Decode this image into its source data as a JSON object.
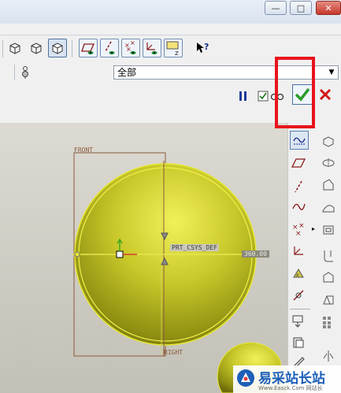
{
  "window": {
    "minimize_label": "—",
    "maximize_label": "□",
    "close_label": "✕"
  },
  "filter": {
    "selected": "全部"
  },
  "graphics": {
    "labels": {
      "front": "FRONT",
      "right": "RIGHT",
      "csys": "PRT_CSYS_DEF",
      "dimension": "360.00"
    }
  },
  "toolbar": {
    "icons": [
      "wireframe-cube-icon",
      "hidden-line-cube-icon",
      "shaded-cube-icon",
      "datum-plane-display-icon",
      "datum-axis-display-icon",
      "datum-point-display-icon",
      "coordinate-system-display-icon",
      "annotation-display-icon",
      "context-help-icon"
    ]
  },
  "dashboard": {
    "icons": [
      "pause-icon",
      "preview-checkbox-icon",
      "glasses-preview-icon",
      "confirm-check-icon",
      "cancel-x-icon"
    ]
  },
  "watermark": {
    "brand": "易采站长站",
    "sub": "Www.Easck.Com 网站长"
  },
  "colors": {
    "sphere": "#c8c82a",
    "highlight": "#e8141c",
    "confirm": "#2a9a2a",
    "cancel": "#d21818",
    "datum": "#8b5a3c"
  }
}
